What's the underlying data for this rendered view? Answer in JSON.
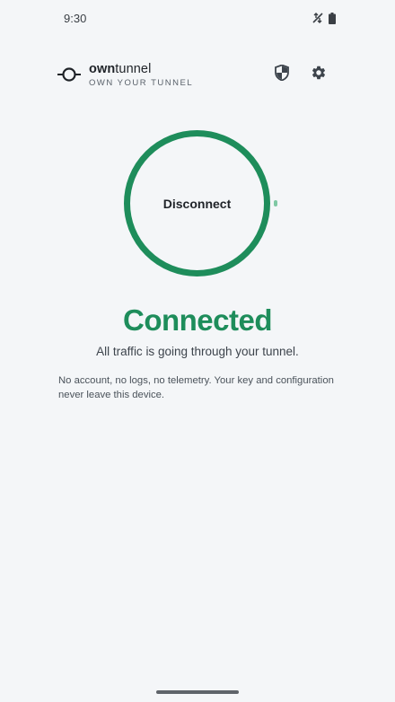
{
  "status_bar": {
    "time": "9:30",
    "icons": [
      "data-saver-icon",
      "battery-icon"
    ]
  },
  "header": {
    "brand_bold": "own",
    "brand_regular": "tunnel",
    "tagline": "OWN YOUR TUNNEL",
    "icons": [
      "logo-icon",
      "shield-icon",
      "gear-icon"
    ]
  },
  "connection": {
    "button_label": "Disconnect",
    "status": "Connected",
    "subtitle": "All traffic is going through your tunnel.",
    "accent_color": "#1e8d5b"
  },
  "privacy_note": "No account, no logs, no telemetry. Your key and configuration never leave this device."
}
